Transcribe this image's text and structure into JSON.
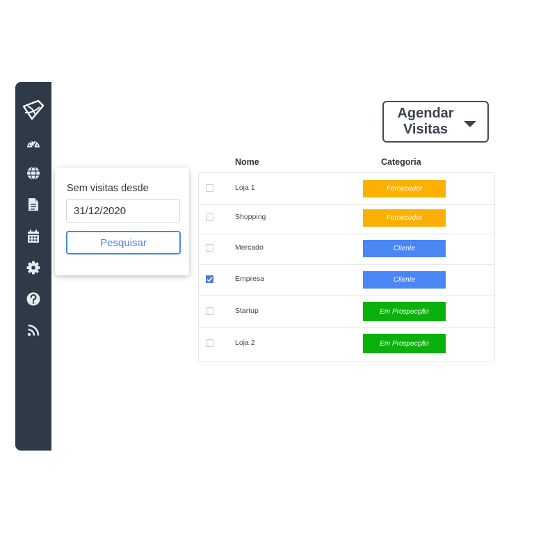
{
  "colors": {
    "sidebar": "#2f3a48",
    "accent": "#4a86e8",
    "fornecedor": "#fbb003",
    "cliente": "#4a86f4",
    "em_prospeccao": "#0ab10a"
  },
  "sidebar": {
    "icons": [
      "logo-icon",
      "dashboard-icon",
      "globe-icon",
      "document-icon",
      "calendar-icon",
      "gear-icon",
      "help-icon",
      "rss-icon"
    ]
  },
  "header": {
    "schedule_label": "Agendar\nVisitas"
  },
  "filter": {
    "title": "Sem visitas desde",
    "date_value": "31/12/2020",
    "search_label": "Pesquisar"
  },
  "table": {
    "columns": [
      "Nome",
      "Categoria"
    ],
    "rows": [
      {
        "name": "Loja 1",
        "category": "Fornecedor",
        "checked": false
      },
      {
        "name": "Shopping",
        "category": "Fornecedor",
        "checked": false
      },
      {
        "name": "Mercado",
        "category": "Cliente",
        "checked": false
      },
      {
        "name": "Empresa",
        "category": "Cliente",
        "checked": true
      },
      {
        "name": "Startup",
        "category": "Em Prospecção",
        "checked": false
      },
      {
        "name": "Loja 2",
        "category": "Em Prospecção",
        "checked": false
      }
    ]
  }
}
